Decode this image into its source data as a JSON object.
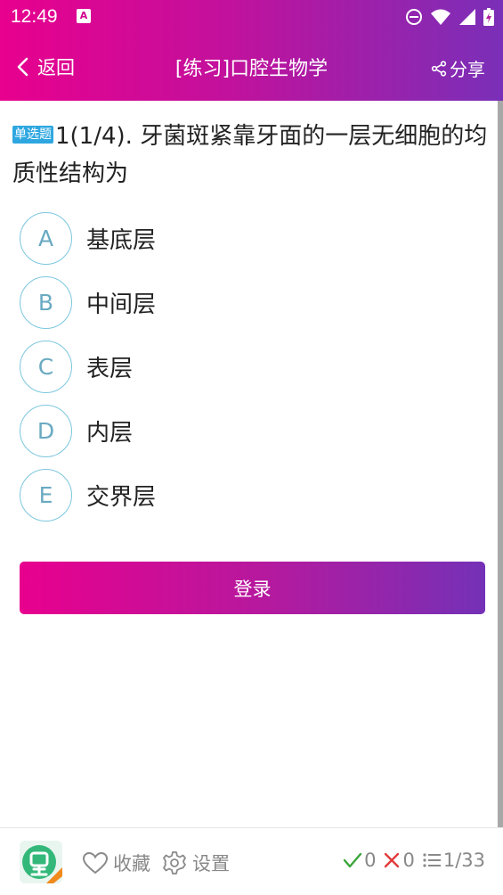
{
  "status_bar": {
    "time": "12:49",
    "notification_letter": "A"
  },
  "nav": {
    "back_label": "返回",
    "title": "[练习]口腔生物学",
    "share_label": "分享"
  },
  "question": {
    "type_badge": "单选题",
    "text": "1(1/4). 牙菌斑紧靠牙面的一层无细胞的均质性结构为"
  },
  "options": [
    {
      "letter": "A",
      "text": "基底层"
    },
    {
      "letter": "B",
      "text": "中间层"
    },
    {
      "letter": "C",
      "text": "表层"
    },
    {
      "letter": "D",
      "text": "内层"
    },
    {
      "letter": "E",
      "text": "交界层"
    }
  ],
  "login_button": "登录",
  "bottom": {
    "favorite_label": "收藏",
    "settings_label": "设置",
    "correct_count": "0",
    "wrong_count": "0",
    "progress": "1/33"
  },
  "colors": {
    "gradient_start": "#e8008e",
    "gradient_end": "#7a2fb8",
    "badge_blue": "#2ea7e0",
    "correct_green": "#3aa53a",
    "wrong_red": "#e23b3b"
  },
  "icons": [
    "chevron-left-icon",
    "share-icon",
    "heart-icon",
    "gear-icon",
    "check-icon",
    "cross-icon",
    "list-icon",
    "app-logo",
    "do-not-disturb-icon",
    "wifi-icon",
    "signal-icon",
    "battery-icon"
  ]
}
